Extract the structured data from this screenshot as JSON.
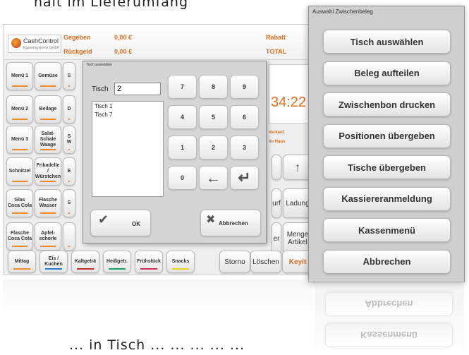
{
  "caption": {
    "top": "halt im Lieferumfang",
    "bottom": "... in Tisch ... ... ... ... ..."
  },
  "app": {
    "logo_name": "CashControl",
    "logo_sub": "Kassensysteme GmbH",
    "gegeben_label": "Gegeben",
    "gegeben_value": "0,00 €",
    "rueckgeld_label": "Rückgeld",
    "rueckgeld_value": "0,00 €",
    "rabatt_label": "Rabatt",
    "total_label": "TOTAL",
    "clock": "34:22",
    "verkauf_label": "Verkauf",
    "im_haus_label": "Im Haus",
    "category_keys": [
      [
        "Menü 1",
        "Gemüse",
        "S"
      ],
      [
        "Menü 2",
        "Beilage",
        "D"
      ],
      [
        "Menü 3",
        "Salat-\nSchale\nWaage",
        "S\nW"
      ],
      [
        "Schnitzel",
        "Frikadelle /\nWürstchen",
        "E"
      ],
      [
        "Glas\nCoca Cola",
        "Flasche\nWasser",
        "S"
      ],
      [
        "Flasche\nCoca Cola",
        "Apfel-\nschorle",
        ""
      ]
    ],
    "bottom_tabs": [
      "Mittag",
      "Eis / Kuchen",
      "Kaltgeträ",
      "Heißgetr.",
      "Frühstück",
      "Snacks"
    ],
    "tab_colors": [
      "#f08a24",
      "#2a7bd4",
      "#c0302a",
      "#22a067",
      "#d0305a",
      "#e8d020"
    ],
    "storno": "Storno",
    "loeschen": "Löschen",
    "keyit": "Keyit",
    "up_arrow": "↑",
    "ladung": "Ladung",
    "urf": "urf",
    "menge_artikel": "Menge\nArtikel",
    "er": "er"
  },
  "dialog": {
    "title": "Tisch auswählen",
    "tisch_label": "Tisch",
    "tisch_value": "2",
    "list": [
      "Tisch 1",
      "Tisch 7"
    ],
    "numpad": [
      "7",
      "8",
      "9",
      "4",
      "5",
      "6",
      "1",
      "2",
      "3",
      "0",
      "←",
      "↵"
    ],
    "ok_label": "OK",
    "cancel_label": "Abbrechen"
  },
  "panel": {
    "title": "Auswahl Zwischenbeleg",
    "buttons": [
      "Tisch auswählen",
      "Beleg aufteilen",
      "Zwischenbon drucken",
      "Positionen übergeben",
      "Tische übergeben",
      "Kassiereranmeldung",
      "Kassenmenü",
      "Abbrechen"
    ]
  },
  "colors": {
    "accent": "#e07020",
    "clock": "#e07020"
  }
}
